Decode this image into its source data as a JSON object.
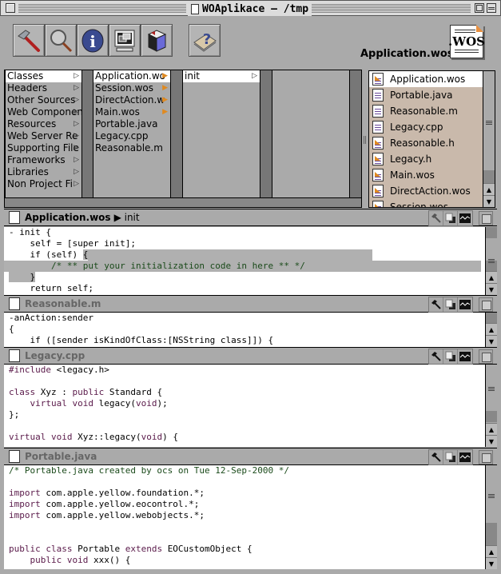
{
  "window": {
    "title": "WOAplikace — /tmp"
  },
  "toolbar": {
    "buttons": [
      {
        "name": "build",
        "icon": "hammer-icon"
      },
      {
        "name": "find",
        "icon": "magnifier-icon"
      },
      {
        "name": "inspector",
        "icon": "info-icon"
      },
      {
        "name": "launch",
        "icon": "monitor-icon"
      },
      {
        "name": "webobjects-builder",
        "icon": "cube-icon"
      }
    ],
    "help_button": {
      "name": "help",
      "icon": "help-book-icon"
    },
    "current_file_label": "Application.wos",
    "current_file_icon_text": ".WOS"
  },
  "browser": {
    "columns": [
      {
        "items": [
          {
            "label": "Classes",
            "selected": true,
            "has_children": true
          },
          {
            "label": "Headers",
            "has_children": true
          },
          {
            "label": "Other Sources",
            "has_children": true
          },
          {
            "label": "Web Componen",
            "has_children": true
          },
          {
            "label": "Resources",
            "has_children": true
          },
          {
            "label": "Web Server Re",
            "has_children": true
          },
          {
            "label": "Supporting File",
            "has_children": true
          },
          {
            "label": "Frameworks",
            "has_children": true
          },
          {
            "label": "Libraries",
            "has_children": true
          },
          {
            "label": "Non Project Fi",
            "has_children": true
          }
        ]
      },
      {
        "items": [
          {
            "label": "Application.wo",
            "selected": true,
            "has_children": true
          },
          {
            "label": "Session.wos",
            "has_children": true
          },
          {
            "label": "DirectAction.w",
            "has_children": true
          },
          {
            "label": "Main.wos",
            "has_children": true
          },
          {
            "label": "Portable.java"
          },
          {
            "label": "Legacy.cpp"
          },
          {
            "label": "Reasonable.m"
          }
        ]
      },
      {
        "items": [
          {
            "label": "init",
            "selected": true,
            "has_children": true
          }
        ]
      },
      {
        "items": []
      }
    ]
  },
  "file_list": {
    "items": [
      {
        "label": "Application.wos",
        "type": "wos",
        "selected": true
      },
      {
        "label": "Portable.java",
        "type": "source"
      },
      {
        "label": "Reasonable.m",
        "type": "source"
      },
      {
        "label": "Legacy.cpp",
        "type": "source"
      },
      {
        "label": "Reasonable.h",
        "type": "wos"
      },
      {
        "label": "Legacy.h",
        "type": "wos"
      },
      {
        "label": "Main.wos",
        "type": "wos"
      },
      {
        "label": "DirectAction.wos",
        "type": "wos"
      },
      {
        "label": "Session.wos",
        "type": "wos"
      }
    ]
  },
  "panes": [
    {
      "title": "Application.wos",
      "subtitle": "▶ init",
      "active": true,
      "lines": [
        [
          {
            "t": "- init {"
          }
        ],
        [
          {
            "t": "    self = [super init];"
          }
        ],
        [
          {
            "t": "    if (self) "
          },
          {
            "t": "{",
            "hl": true
          }
        ],
        [
          {
            "t": "        /* ** put your initialization code in here ** */",
            "c": "cm",
            "hl": true,
            "full": true
          }
        ],
        [
          {
            "t": "    }",
            "hl": true
          }
        ],
        [
          {
            "t": "    return self;"
          }
        ]
      ]
    },
    {
      "title": "Reasonable.m",
      "subtitle": "",
      "active": false,
      "lines": [
        [
          {
            "t": "-anAction:sender"
          }
        ],
        [
          {
            "t": "{"
          }
        ],
        [
          {
            "t": "    if ([sender isKindOfClass:[NSString class]]) {"
          }
        ]
      ]
    },
    {
      "title": "Legacy.cpp",
      "subtitle": "",
      "active": false,
      "lines": [
        [
          {
            "t": "#include ",
            "c": "kw"
          },
          {
            "t": "<legacy.h>"
          }
        ],
        [
          {
            "t": ""
          }
        ],
        [
          {
            "t": "class ",
            "c": "kw"
          },
          {
            "t": "Xyz : "
          },
          {
            "t": "public ",
            "c": "kw"
          },
          {
            "t": "Standard {"
          }
        ],
        [
          {
            "t": "    "
          },
          {
            "t": "virtual void ",
            "c": "kw"
          },
          {
            "t": "legacy("
          },
          {
            "t": "void",
            "c": "kw"
          },
          {
            "t": ");"
          }
        ],
        [
          {
            "t": "};"
          }
        ],
        [
          {
            "t": ""
          }
        ],
        [
          {
            "t": "virtual void ",
            "c": "kw"
          },
          {
            "t": "Xyz::legacy("
          },
          {
            "t": "void",
            "c": "kw"
          },
          {
            "t": ") {"
          }
        ]
      ]
    },
    {
      "title": "Portable.java",
      "subtitle": "",
      "active": false,
      "lines": [
        [
          {
            "t": "/* Portable.java created by ocs on Tue 12-Sep-2000 */",
            "c": "cm"
          }
        ],
        [
          {
            "t": ""
          }
        ],
        [
          {
            "t": "import ",
            "c": "kw"
          },
          {
            "t": "com.apple.yellow.foundation.*;"
          }
        ],
        [
          {
            "t": "import ",
            "c": "kw"
          },
          {
            "t": "com.apple.yellow.eocontrol.*;"
          }
        ],
        [
          {
            "t": "import ",
            "c": "kw"
          },
          {
            "t": "com.apple.yellow.webobjects.*;"
          }
        ],
        [
          {
            "t": ""
          }
        ],
        [
          {
            "t": ""
          }
        ],
        [
          {
            "t": "public class ",
            "c": "kw"
          },
          {
            "t": "Portable "
          },
          {
            "t": "extends ",
            "c": "kw"
          },
          {
            "t": "EOCustomObject {"
          }
        ],
        [
          {
            "t": "    "
          },
          {
            "t": "public void ",
            "c": "kw"
          },
          {
            "t": "xxx() {"
          }
        ]
      ]
    }
  ],
  "colors": {
    "keyword": "#5a1a4a",
    "comment": "#1a4a1a",
    "selection": "#b0b0b0",
    "file_list_bg": "#c9b9ab",
    "accent_orange": "#e08a20"
  }
}
